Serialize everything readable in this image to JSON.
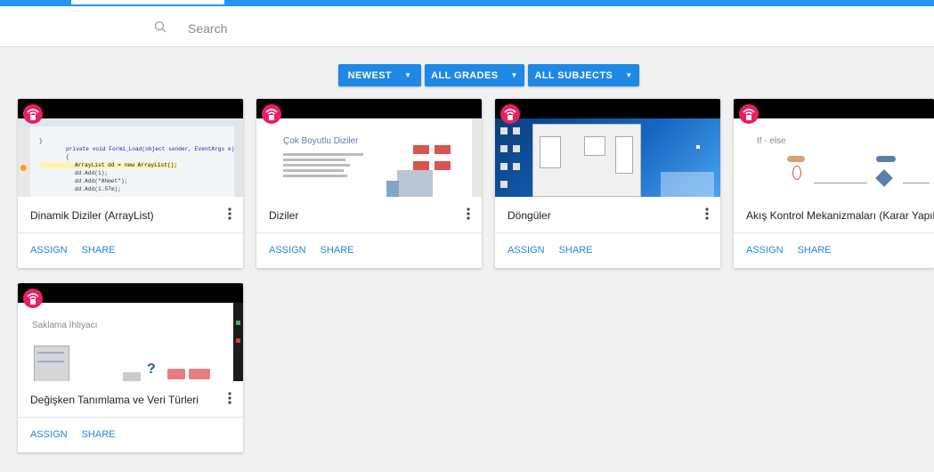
{
  "search": {
    "placeholder": "Search"
  },
  "filters": [
    {
      "label": "NEWEST"
    },
    {
      "label": "ALL GRADES"
    },
    {
      "label": "ALL SUBJECTS"
    }
  ],
  "colors": {
    "accent": "#2196f3",
    "button": "#1e88e5",
    "badge": "#e91e63"
  },
  "cards": [
    {
      "title": "Dinamik Diziler (ArrayList)",
      "assign": "ASSIGN",
      "share": "SHARE",
      "thumb_text": [
        "}",
        "private void Form1_Load(object sender, EventArgs e)",
        "{",
        "ArrayList dd = new ArrayList();",
        "dd.Add(1);",
        "dd.Add(\"Ahmet\");",
        "dd.Add(1.57m);"
      ]
    },
    {
      "title": "Diziler",
      "assign": "ASSIGN",
      "share": "SHARE",
      "thumb_text": [
        "Çok Boyutlu Diziler"
      ]
    },
    {
      "title": "Döngüler",
      "assign": "ASSIGN",
      "share": "SHARE",
      "thumb_text": []
    },
    {
      "title": "Akış Kontrol Mekanizmaları (Karar Yapıları)",
      "assign": "ASSIGN",
      "share": "SHARE",
      "thumb_text": [
        "If - else"
      ]
    },
    {
      "title": "Değişken Tanımlama ve Veri Türleri",
      "assign": "ASSIGN",
      "share": "SHARE",
      "thumb_text": [
        "Saklama İhtiyacı"
      ]
    }
  ]
}
